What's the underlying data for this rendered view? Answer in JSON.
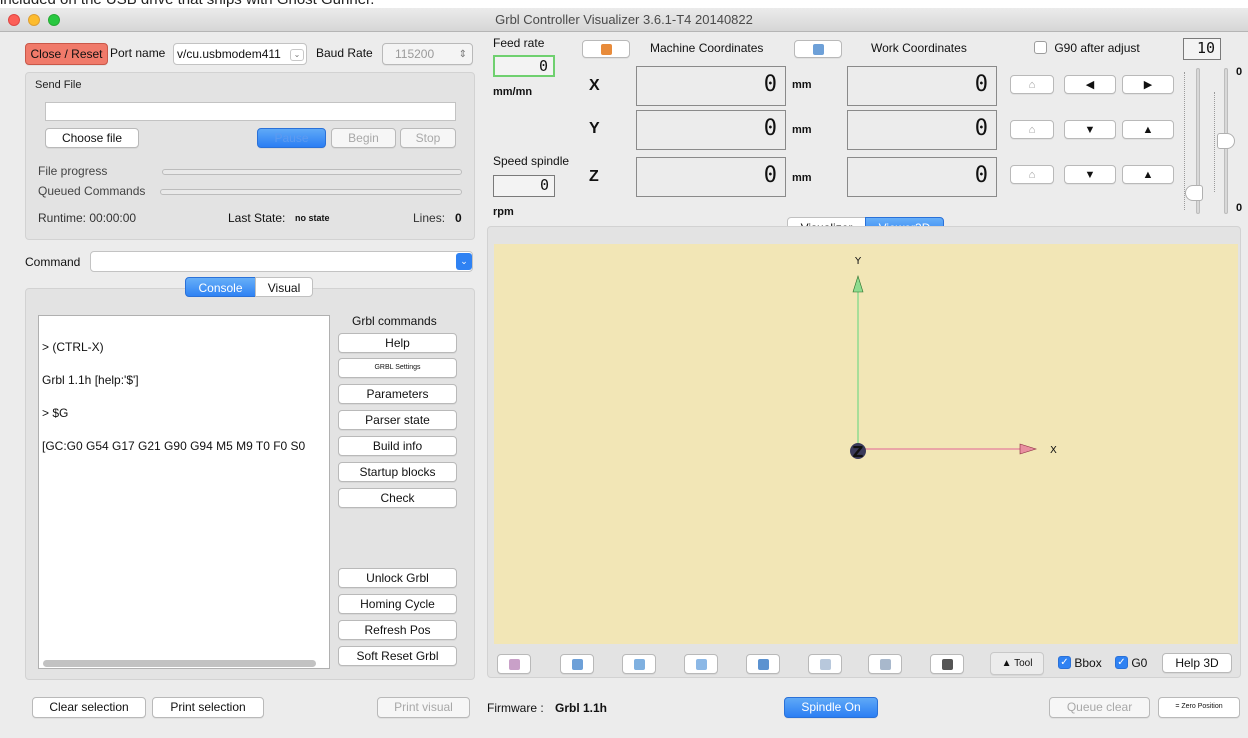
{
  "caption_top": "included on the USB drive that ships with Ghost Gunner.",
  "window": {
    "title": "Grbl Controller Visualizer 3.6.1-T4  20140822"
  },
  "connection": {
    "close_reset_label": "Close / Reset",
    "port_label": "Port name",
    "port_value": "v/cu.usbmodem411",
    "baud_label": "Baud Rate",
    "baud_value": "115200"
  },
  "send_file": {
    "title": "Send File",
    "path_value": "",
    "choose_label": "Choose file",
    "pause_label": "Pause",
    "begin_label": "Begin",
    "stop_label": "Stop",
    "file_progress_label": "File progress",
    "file_progress": 0,
    "queued_label": "Queued Commands",
    "queued_progress": 0,
    "runtime_text": "Runtime: 00:00:00",
    "last_state_label": "Last State:",
    "last_state_value": "no state",
    "lines_label": "Lines:",
    "lines_value": "0"
  },
  "command": {
    "label": "Command",
    "value": ""
  },
  "console_tabs": [
    "Console",
    "Visual"
  ],
  "console_lines": [
    "> (CTRL-X)",
    "Grbl 1.1h [help:'$']",
    "> $G",
    "[GC:G0 G54 G17 G21 G90 G94 M5 M9 T0 F0 S0"
  ],
  "grbl_commands": {
    "title": "Grbl commands",
    "top": [
      "Help",
      "GRBL Settings",
      "Parameters",
      "Parser state",
      "Build info",
      "Startup blocks",
      "Check"
    ],
    "bottom": [
      "Unlock Grbl",
      "Homing Cycle",
      "Refresh Pos",
      "Soft Reset Grbl"
    ]
  },
  "bottom_left": {
    "clear_selection": "Clear selection",
    "print_selection": "Print selection",
    "print_visual": "Print visual"
  },
  "feed": {
    "label": "Feed rate",
    "value": "0",
    "unit": "mm/mn"
  },
  "spindle": {
    "label": "Speed spindle",
    "value": "0",
    "unit": "rpm"
  },
  "coords": {
    "machine_label": "Machine Coordinates",
    "work_label": "Work Coordinates",
    "g90_label": "G90 after adjust",
    "g90_checked": false,
    "step_value": "10",
    "unit": "mm",
    "axes": [
      {
        "name": "X",
        "machine": "0",
        "work": "0"
      },
      {
        "name": "Y",
        "machine": "0",
        "work": "0"
      },
      {
        "name": "Z",
        "machine": "0",
        "work": "0"
      }
    ]
  },
  "slider": {
    "top_label": "0",
    "bottom_label": "0",
    "value": 0
  },
  "viewer_tabs": [
    "Visualizer",
    "Viewer3D"
  ],
  "viewer": {
    "background": "#f2e6b6",
    "y_axis_color": "#8fdc8f",
    "x_axis_color": "#e88fa0",
    "x_label": "X",
    "y_label": "Y",
    "z_label": "Z"
  },
  "viewer_toolbar": {
    "view_icons": [
      "iso-view-icon",
      "front-view-icon",
      "back-view-icon",
      "left-view-icon",
      "right-view-icon",
      "top-view-icon",
      "bottom-view-icon",
      "tool-view-icon"
    ],
    "tool_label": "Tool",
    "bbox_label": "Bbox",
    "bbox_checked": true,
    "g0_label": "G0",
    "g0_checked": true,
    "help_label": "Help 3D"
  },
  "status": {
    "firmware_label": "Firmware :",
    "firmware_value": "Grbl 1.1h",
    "spindle_button": "Spindle On",
    "queue_clear": "Queue clear",
    "zero_position": "= Zero Position"
  },
  "colors": {
    "accent": "#2f82f3",
    "close_reset": "#f07a6a"
  }
}
